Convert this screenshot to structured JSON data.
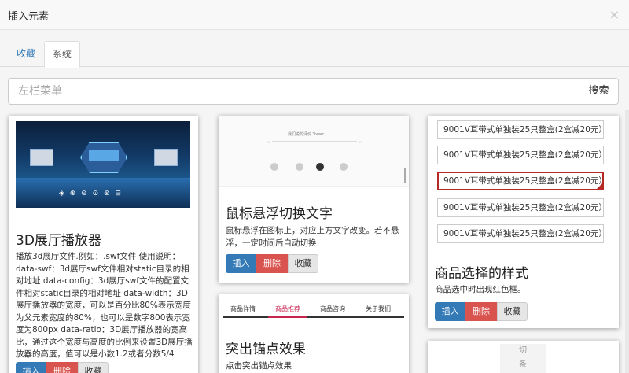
{
  "dialog": {
    "title": "插入元素",
    "close": "×"
  },
  "tabs": [
    {
      "label": "收藏"
    },
    {
      "label": "系统"
    }
  ],
  "search": {
    "placeholder": "左栏菜单",
    "button": "搜索"
  },
  "buttons": {
    "insert": "插入",
    "delete": "删除",
    "favorite": "收藏"
  },
  "cards": [
    {
      "title": "3D展厅播放器",
      "image_controls": "◈ ⊕ ⊖ ⊙ ⊛ ⊟",
      "description": "播放3d展厅文件.例如：.swf文件 使用说明：data-swf：3d展厅swf文件相对static目录的相对地址 data-config：3d展厅swf文件的配置文件相对static目录的相对地址 data-width：3D展厅播放器的宽度，可以是百分比80%表示宽度为父元素宽度的80%，也可以是数字800表示宽度为800px data-ratio：3D展厅播放器的宽高比，通过这个宽度与高度的比例来设置3D展厅播放器的高度，值可以是小数1.2或者分数5/4"
    },
    {
      "title": "鼠标悬浮切换文字",
      "image_caption": "我们说的评价 Tower",
      "description": "鼠标悬浮在图标上，对应上方文字改变。若不悬浮，一定时间后自动切换"
    },
    {
      "title": "突出锚点效果",
      "nav_tabs": [
        "商品详情",
        "商品推荐",
        "商品咨询",
        "关于我们"
      ],
      "description": "点击突出锚点效果"
    },
    {
      "title": "商品选择的样式",
      "items": [
        "9001V耳带式单独装25只整盒(2盒减20元）",
        "9001V耳带式单独装25只整盒(2盒减20元）",
        "9001V耳带式单独装25只整盒(2盒减20元）",
        "9001V耳带式单独装25只整盒(2盒减20元）",
        "9001V耳带式单独装25只整盒(2盒减20元）"
      ],
      "selected_index": 2,
      "description": "商品选中时出现红色框。"
    },
    {
      "partial_text": [
        "切",
        "条"
      ]
    }
  ],
  "colors": {
    "primary": "#337ab7",
    "danger": "#d9534f",
    "selected_border": "#b52a25",
    "anchor_active": "#c7254e"
  }
}
